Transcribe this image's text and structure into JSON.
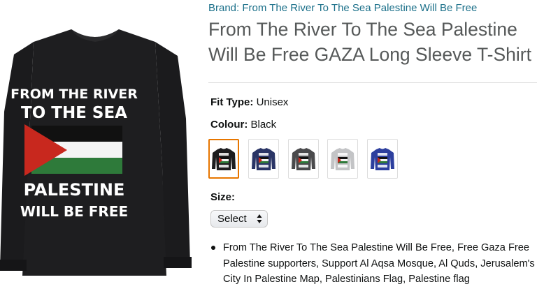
{
  "product_image": {
    "shirt_lines": [
      "FROM THE RIVER",
      "TO THE SEA",
      "PALESTINE",
      "WILL BE FREE"
    ]
  },
  "brand": "Brand: From The River To The Sea Palestine Will Be Free",
  "title_lines": [
    "From The River To The Sea Palestine",
    "Will Be Free GAZA Long Sleeve T-Shirt"
  ],
  "fit_type": {
    "label": "Fit Type:",
    "value": "Unisex"
  },
  "colour": {
    "label": "Colour:",
    "value": "Black",
    "swatches": [
      {
        "name": "Black",
        "color": "#1d1d1f",
        "selected": true
      },
      {
        "name": "Navy",
        "color": "#2a3566",
        "selected": false
      },
      {
        "name": "Dark Heather",
        "color": "#4a4a4c",
        "selected": false
      },
      {
        "name": "Grey Heather",
        "color": "#c3c4c6",
        "selected": false
      },
      {
        "name": "Royal Blue",
        "color": "#2d3f9e",
        "selected": false
      }
    ]
  },
  "size": {
    "label": "Size:",
    "select_value": "Select"
  },
  "bullets": [
    "From The River To The Sea Palestine Will Be Free, Free Gaza Free Palestine supporters, Support Al Aqsa Mosque, Al Quds, Jerusalem's City In Palestine Map, Palestinians Flag, Palestine flag"
  ],
  "colors": {
    "flag_red": "#c8281e",
    "flag_black": "#111111",
    "flag_white": "#f4f4f4",
    "flag_green": "#2e7a3a",
    "link": "#1a6f89",
    "selected_border": "#e77600"
  }
}
